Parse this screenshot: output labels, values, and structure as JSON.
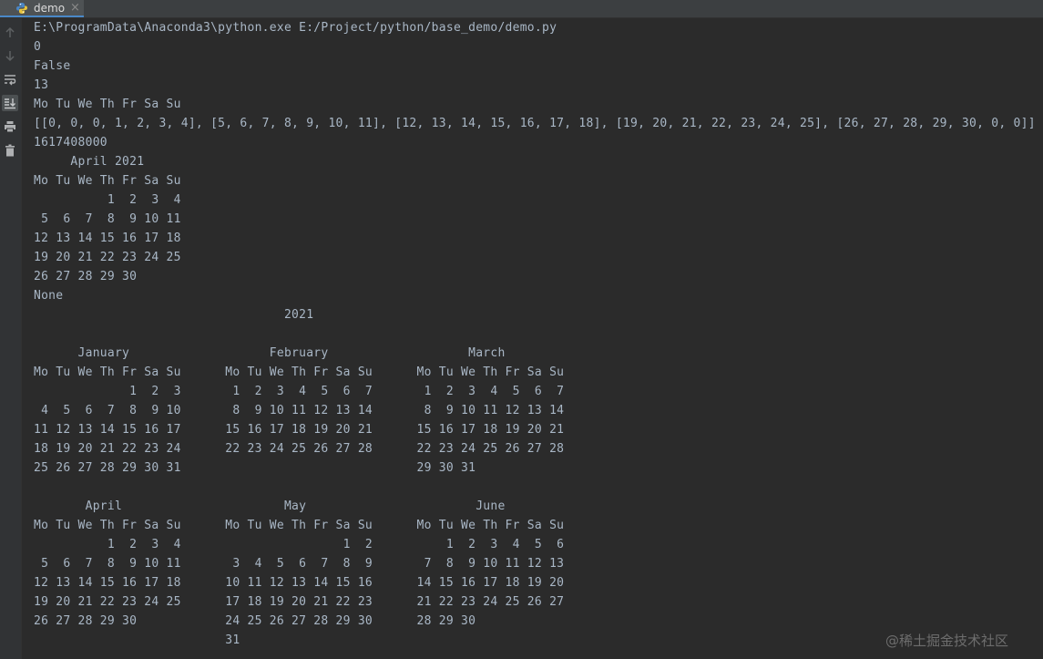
{
  "tab": {
    "label": "demo",
    "close_glyph": "×",
    "icon": "python-icon"
  },
  "toolbar": {
    "icons": [
      "arrow-up-icon",
      "arrow-down-icon",
      "soft-wrap-icon",
      "scroll-to-end-icon",
      "print-icon",
      "trash-icon"
    ],
    "active": "scroll-to-end-icon"
  },
  "colors": {
    "background": "#2b2b2b",
    "text": "#a9b7c6",
    "tab_accent": "#4a88c7"
  },
  "console": {
    "lines": [
      "E:\\ProgramData\\Anaconda3\\python.exe E:/Project/python/base_demo/demo.py",
      "0",
      "False",
      "13",
      "Mo Tu We Th Fr Sa Su",
      "[[0, 0, 0, 1, 2, 3, 4], [5, 6, 7, 8, 9, 10, 11], [12, 13, 14, 15, 16, 17, 18], [19, 20, 21, 22, 23, 24, 25], [26, 27, 28, 29, 30, 0, 0]]",
      "1617408000",
      "     April 2021",
      "Mo Tu We Th Fr Sa Su",
      "          1  2  3  4",
      " 5  6  7  8  9 10 11",
      "12 13 14 15 16 17 18",
      "19 20 21 22 23 24 25",
      "26 27 28 29 30",
      "None",
      "                                  2021",
      "",
      "      January                   February                   March",
      "Mo Tu We Th Fr Sa Su      Mo Tu We Th Fr Sa Su      Mo Tu We Th Fr Sa Su",
      "             1  2  3       1  2  3  4  5  6  7       1  2  3  4  5  6  7",
      " 4  5  6  7  8  9 10       8  9 10 11 12 13 14       8  9 10 11 12 13 14",
      "11 12 13 14 15 16 17      15 16 17 18 19 20 21      15 16 17 18 19 20 21",
      "18 19 20 21 22 23 24      22 23 24 25 26 27 28      22 23 24 25 26 27 28",
      "25 26 27 28 29 30 31                                29 30 31",
      "",
      "       April                      May                       June",
      "Mo Tu We Th Fr Sa Su      Mo Tu We Th Fr Sa Su      Mo Tu We Th Fr Sa Su",
      "          1  2  3  4                      1  2          1  2  3  4  5  6",
      " 5  6  7  8  9 10 11       3  4  5  6  7  8  9       7  8  9 10 11 12 13",
      "12 13 14 15 16 17 18      10 11 12 13 14 15 16      14 15 16 17 18 19 20",
      "19 20 21 22 23 24 25      17 18 19 20 21 22 23      21 22 23 24 25 26 27",
      "26 27 28 29 30            24 25 26 27 28 29 30      28 29 30",
      "                          31"
    ]
  },
  "watermark": "@稀土掘金技术社区"
}
